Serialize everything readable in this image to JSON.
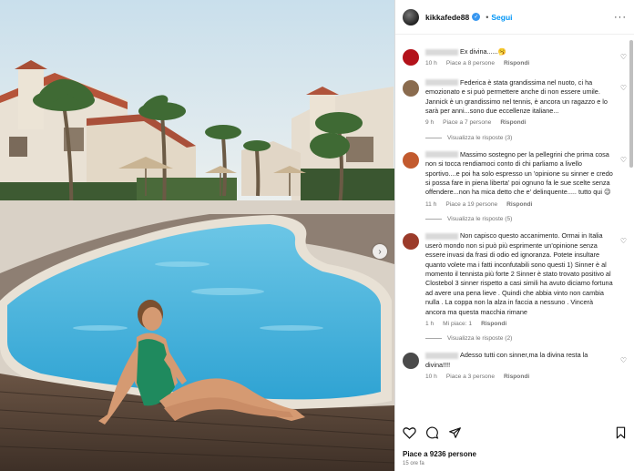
{
  "post": {
    "username": "kikkafede88",
    "follow_label": "Segui",
    "more_label": "···",
    "likes_text": "Piace a 9236 persone",
    "time_text": "15 ore fa"
  },
  "comments": [
    {
      "avatar_color": "#b3121a",
      "text": "Ex divina......🥱",
      "time": "10 h",
      "likes": "Piace a 8 persone",
      "reply": "Rispondi"
    },
    {
      "avatar_color": "#8a6b4e",
      "text": "Federica è stata grandissima nel nuoto, ci ha emozionato e si può permettere anche di non essere umile. Jannick è un grandissimo nel tennis, è ancora un ragazzo e lo sarà per anni...sono due eccellenze italiane...",
      "time": "9 h",
      "likes": "Piace a 7 persone",
      "reply": "Rispondi",
      "view_replies": "Visualizza le risposte (3)"
    },
    {
      "avatar_color": "#c25a2e",
      "text": "Massimo sostegno per la pellegrini che prima cosa non si tocca rendiamoci conto di chi parliamo a livello sportivo....e poi ha solo espresso un 'opinione su sinner e credo si possa fare in piena liberta' poi ognuno fa le sue scelte senza offendere...non ha mica detto che e' delinquente..... tutto qui 😉",
      "time": "11 h",
      "likes": "Piace a 19 persone",
      "reply": "Rispondi",
      "view_replies": "Visualizza le risposte (5)"
    },
    {
      "avatar_color": "#9b3b2a",
      "text": "Non capisco questo accanimento. Ormai in Italia userò mondo non si può più esprimente un'opinione senza essere invasi da frasi di odio ed ignoranza. Potete insultare quanto volete ma i fatti inconfutabili sono questi 1) Sinner è al momento il tennista più forte 2 Sinner è stato trovato positivo al Clostebol 3 sinner rispetto a casi simili ha avuto diciamo fortuna ad avere una pena lieve . Quindi che abbia vinto non cambia nulla . La coppa non la alza in faccia a nessuno . Vincerà ancora ma questa macchia rimane",
      "time": "1 h",
      "likes": "Mi piace: 1",
      "reply": "Rispondi",
      "view_replies": "Visualizza le risposte (2)"
    },
    {
      "avatar_color": "#4a4a4a",
      "text": "Adesso tutti con sinner,ma la divina resta la divina!!!!",
      "time": "10 h",
      "likes": "Piace a 3 persone",
      "reply": "Rispondi"
    }
  ],
  "icons": {
    "like": "heart-icon",
    "comment": "comment-icon",
    "share": "share-icon",
    "save": "bookmark-icon"
  }
}
